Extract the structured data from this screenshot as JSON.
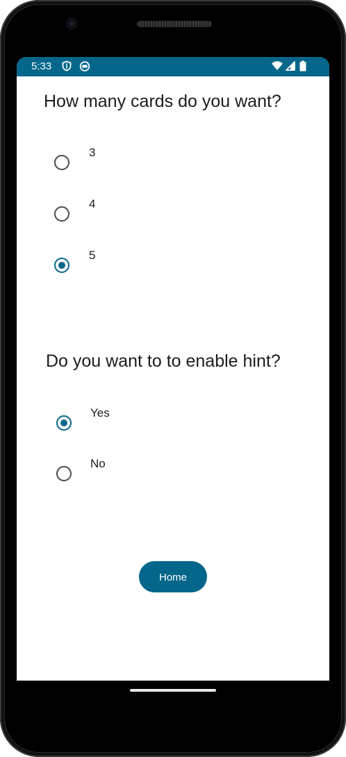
{
  "status_bar": {
    "time": "5:33",
    "background_color": "#03668a",
    "left_icons": [
      "shield-icon",
      "app-notification-icon"
    ],
    "right_icons": [
      "wifi-icon",
      "cell-signal-icon",
      "battery-icon"
    ]
  },
  "cards_question": {
    "title": "How many cards do you want?",
    "options": [
      {
        "label": "3",
        "selected": false
      },
      {
        "label": "4",
        "selected": false
      },
      {
        "label": "5",
        "selected": true
      }
    ]
  },
  "hint_question": {
    "title": "Do you want to to enable hint?",
    "options": [
      {
        "label": "Yes",
        "selected": true
      },
      {
        "label": "No",
        "selected": false
      }
    ]
  },
  "home_button": {
    "label": "Home"
  },
  "colors": {
    "accent": "#03668a",
    "text": "#1c1c1c",
    "radio_unchecked": "#4a4a4a"
  }
}
